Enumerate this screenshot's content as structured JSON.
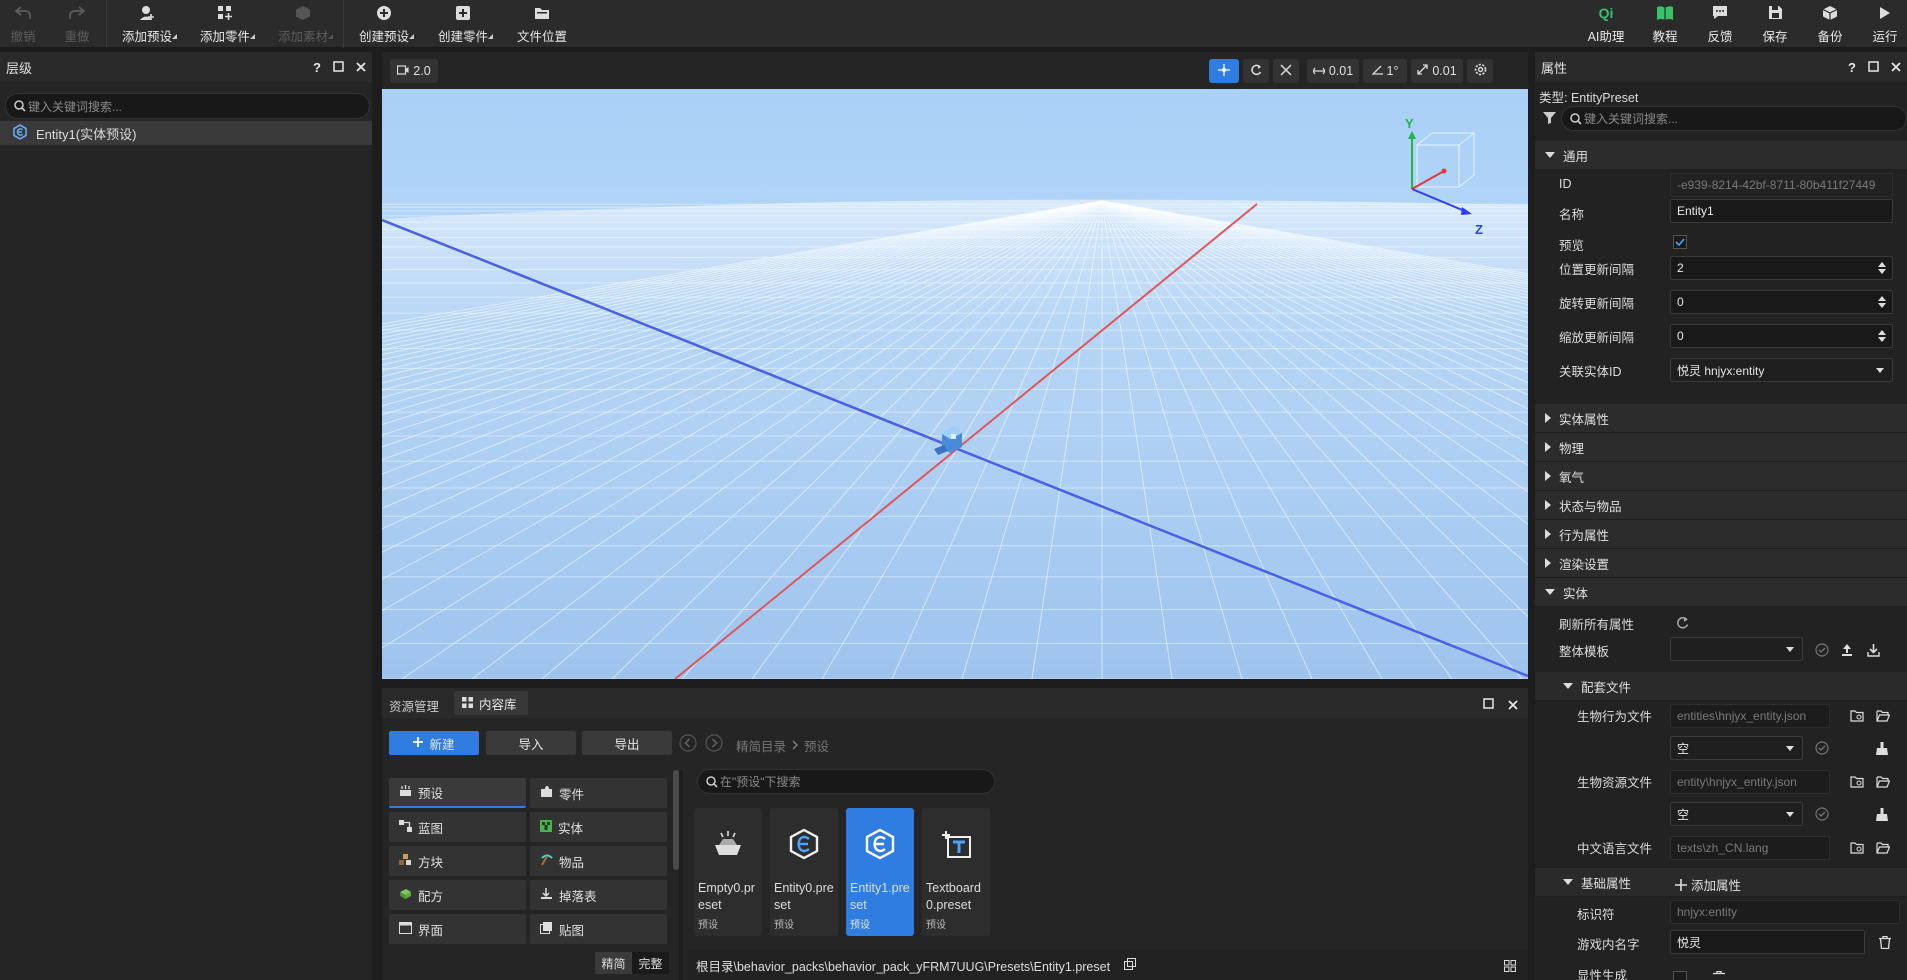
{
  "toolbar": {
    "undo": "撤销",
    "redo": "重做",
    "add_preset": "添加预设",
    "add_part": "添加零件",
    "add_material": "添加素材",
    "create_preset": "创建预设",
    "create_part": "创建零件",
    "file_location": "文件位置",
    "ai_assistant": "AI助理",
    "ai_badge": "Qi",
    "tutorial": "教程",
    "feedback": "反馈",
    "save": "保存",
    "backup": "备份",
    "run": "运行"
  },
  "hierarchy": {
    "title": "层级",
    "help": "?",
    "search_placeholder": "键入关键词搜索...",
    "items": [
      {
        "label": "Entity1(实体预设)"
      }
    ]
  },
  "viewport": {
    "camera_speed": "2.0",
    "move_snap": "0.01",
    "rotate_snap": "1°",
    "scale_snap": "0.01",
    "gizmo_axes": {
      "y": "Y",
      "z": "Z"
    },
    "colors": {
      "sky_top": "#a9d0f7",
      "ground": "#a5c8f0",
      "x_axis": "#e05757",
      "z_axis": "#4a5fe8"
    }
  },
  "bottom": {
    "tabs": [
      "资源管理",
      "内容库"
    ],
    "new_btn": "新建",
    "import_btn": "导入",
    "export_btn": "导出",
    "breadcrumb": [
      "精简目录",
      "预设"
    ],
    "search_placeholder": "在\"预设\"下搜索",
    "categories": [
      {
        "label": "预设"
      },
      {
        "label": "零件"
      },
      {
        "label": "蓝图"
      },
      {
        "label": "实体"
      },
      {
        "label": "方块"
      },
      {
        "label": "物品"
      },
      {
        "label": "配方"
      },
      {
        "label": "掉落表"
      },
      {
        "label": "界面"
      },
      {
        "label": "贴图"
      }
    ],
    "assets": [
      {
        "name": "Empty0.preset",
        "type": "预设"
      },
      {
        "name": "Entity0.preset",
        "type": "预设"
      },
      {
        "name": "Entity1.preset",
        "type": "预设"
      },
      {
        "name": "Textboard0.preset",
        "type": "预设"
      }
    ],
    "mode_simple": "精简",
    "mode_full": "完整",
    "path": "根目录\\behavior_packs\\behavior_pack_yFRM7UUG\\Presets\\Entity1.preset"
  },
  "properties": {
    "title": "属性",
    "help": "?",
    "type_label": "类型: EntityPreset",
    "search_placeholder": "键入关键词搜索...",
    "general": "通用",
    "id_label": "ID",
    "id_value": "-e939-8214-42bf-8711-80b411f27449",
    "name_label": "名称",
    "name_value": "Entity1",
    "preview_label": "预览",
    "pos_interval_label": "位置更新间隔",
    "pos_interval_value": "2",
    "rot_interval_label": "旋转更新间隔",
    "rot_interval_value": "0",
    "scale_interval_label": "缩放更新间隔",
    "scale_interval_value": "0",
    "entity_id_label": "关联实体ID",
    "entity_id_value": "悦灵 hnjyx:entity",
    "sections": [
      "实体属性",
      "物理",
      "氧气",
      "状态与物品",
      "行为属性",
      "渲染设置"
    ],
    "entity_section": "实体",
    "refresh_label": "刷新所有属性",
    "template_label": "整体模板",
    "config_files": "配套文件",
    "behavior_file_label": "生物行为文件",
    "behavior_file_value": "entities\\hnjyx_entity.json",
    "empty": "空",
    "resource_file_label": "生物资源文件",
    "resource_file_value": "entity\\hnjyx_entity.json",
    "lang_file_label": "中文语言文件",
    "lang_file_value": "texts\\zh_CN.lang",
    "basic_attrs": "基础属性",
    "add_attr": "添加属性",
    "identifier_label": "标识符",
    "identifier_value": "hnjyx:entity",
    "ingame_name_label": "游戏内名字",
    "ingame_name_value": "悦灵",
    "last_row_label": "显性生成"
  }
}
